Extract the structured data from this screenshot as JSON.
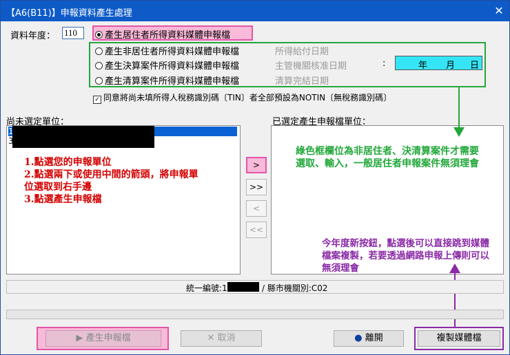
{
  "window": {
    "title": "【A6(B11)】申報資料產生處理",
    "close_glyph": "✕"
  },
  "form": {
    "year_label": "資料年度：",
    "year_value": "110",
    "radio_options": [
      "產生居住者所得資料媒體申報檔",
      "產生非居住者所得資料媒體申報檔",
      "產生決算案件所得資料媒體申報檔",
      "產生清算案件所得資料媒體申報檔"
    ],
    "date_labels": [
      "所得給付日期",
      "主管機關核准日期",
      "清算完結日期"
    ],
    "colon": ":",
    "date_parts": [
      "年",
      "月",
      "日"
    ],
    "checkbox_label": "同意將尚未填所得人稅務識別碼〔TIN〕者全部預設為NOTIN〔無稅務識別碼〕",
    "check_glyph": "✓"
  },
  "lists": {
    "left_label": "尚未選定單位：",
    "left_items": [
      "1",
      "3"
    ],
    "right_label": "已選定產生申報檔單位："
  },
  "move_buttons": [
    ">",
    ">>",
    "<",
    "<<"
  ],
  "annotations": {
    "red_lines": [
      "1.點選您的申報單位",
      "2.點選兩下或使用中間的箭頭，將申報單",
      "位選取到右手邊",
      "3.點選產生申報檔"
    ],
    "green_text": "綠色框欄位為非居住者、決清算案件才需要選取、輸入，一般居住者申報案件無須理會",
    "purple_text": "今年度新按鈕，點選後可以直接跳到媒體檔案複製，若要透過網路申報上傳則可以無須理會"
  },
  "status": {
    "prefix": "統一編號:1",
    "suffix": "/ 縣市機關別:C02"
  },
  "buttons": {
    "generate": "產生申報檔",
    "cancel": "取消",
    "leave": "離開",
    "copy": "複製媒體檔"
  },
  "colors": {
    "title_bar": "#0e5bc8",
    "pink": "#e455a8",
    "green": "#23a63a",
    "purple": "#8a2aa6",
    "date_fill": "#35e5f5"
  }
}
